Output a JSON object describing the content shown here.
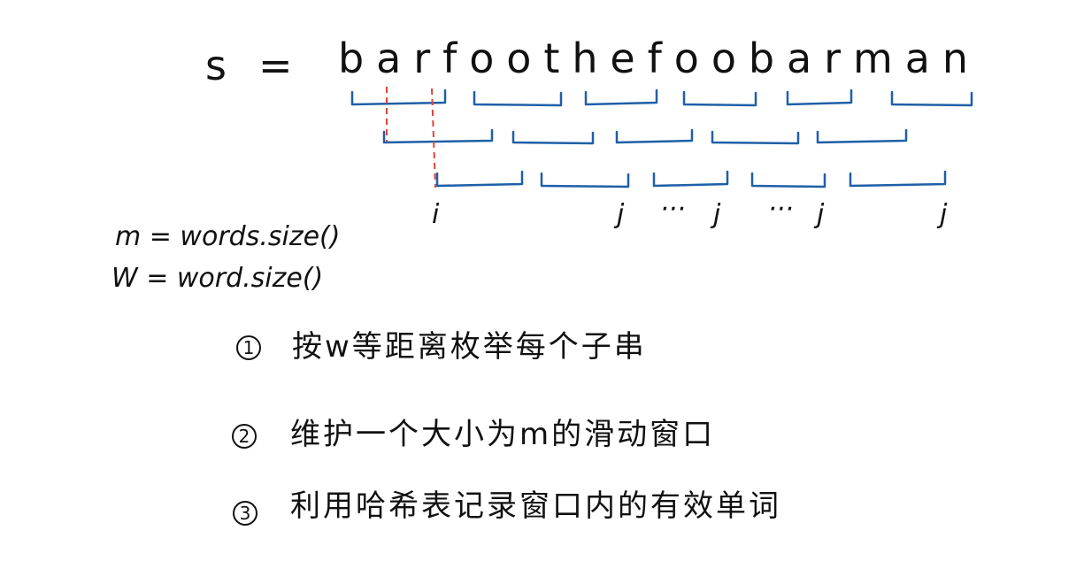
{
  "string_line": {
    "lhs": "s",
    "equals": "=",
    "value": "b a r f o o t h e f o o b a r m a n"
  },
  "pointer_labels": {
    "i": "i",
    "j": "j",
    "dots": "···"
  },
  "formulas": {
    "m": "m = words.size()",
    "w": "W = word.size()"
  },
  "steps": [
    {
      "num": "1",
      "text": "按w等距离枚举每个子串"
    },
    {
      "num": "2",
      "text": "维护一个大小为m的滑动窗口"
    },
    {
      "num": "3",
      "text": "利用哈希表记录窗口内的有效单词"
    }
  ],
  "colors": {
    "ink": "#111111",
    "bracket": "#1f5fa8",
    "marker": "#e0443a"
  }
}
